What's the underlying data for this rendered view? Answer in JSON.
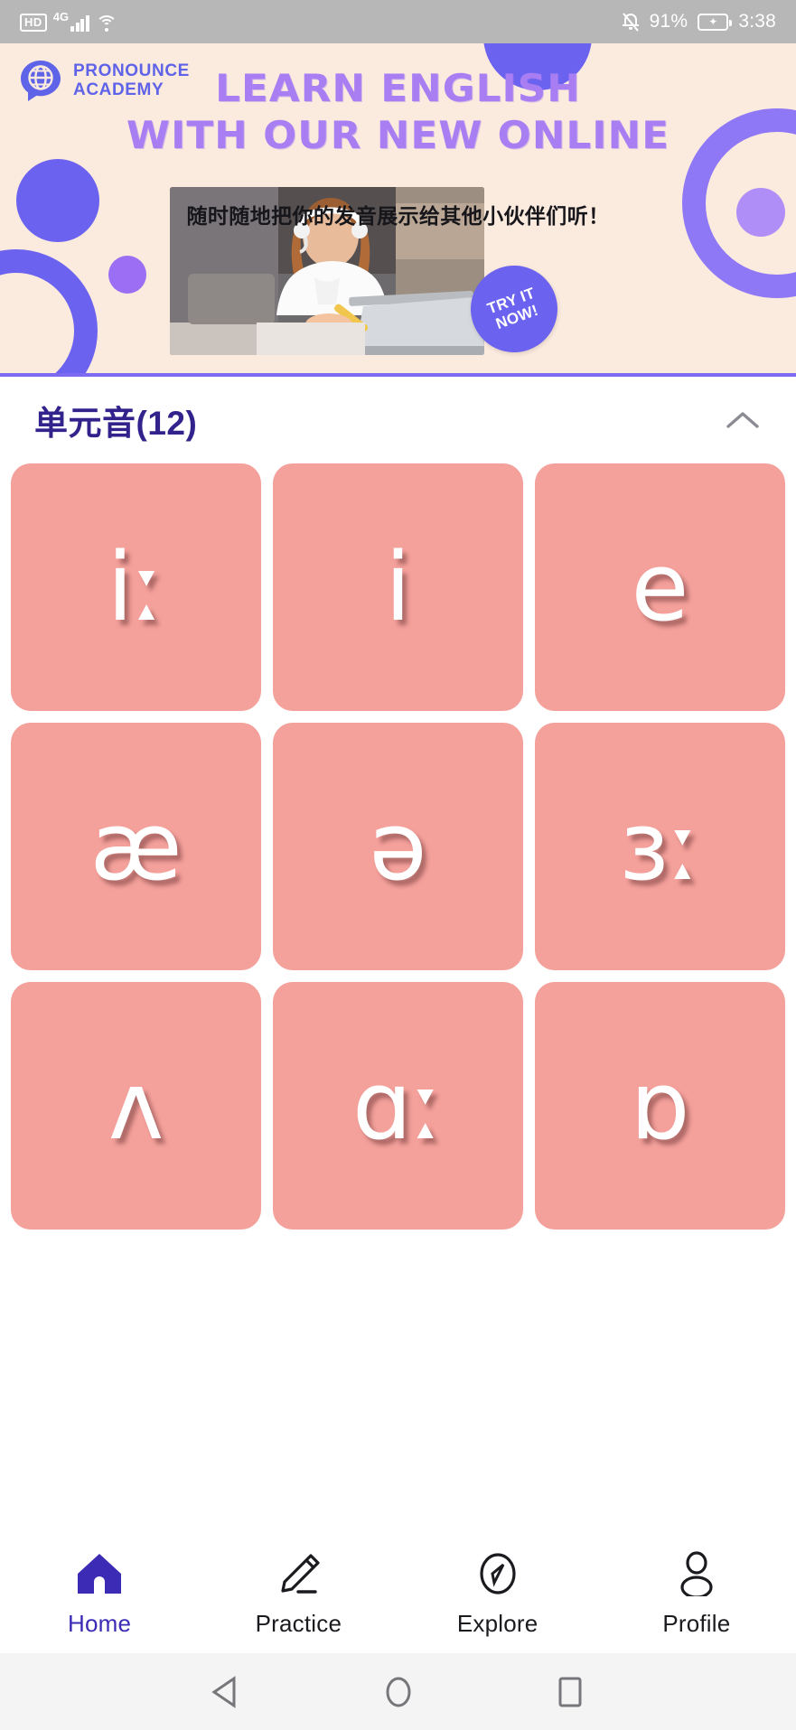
{
  "status_bar": {
    "hd_label": "HD",
    "network_label": "4G",
    "icons": [
      "hd-icon",
      "signal-bars-icon",
      "wifi-icon",
      "bell-muted-icon",
      "battery-charging-icon"
    ],
    "battery_percent": "91%",
    "clock": "3:38"
  },
  "banner": {
    "logo_name_line1": "PRONOUNCE",
    "logo_name_line2": "ACADEMY",
    "headline_line1": "LEARN ENGLISH",
    "headline_line2": "WITH OUR NEW ONLINE",
    "subline": "随时随地把你的发音展示给其他小伙伴们听！",
    "cta_line1": "TRY IT",
    "cta_line2": "NOW!",
    "photo_alt": "woman-with-headset-at-laptop",
    "colors": {
      "background": "#fbeade",
      "headline": "#a97ef2",
      "brand_blue": "#6b63ef",
      "logo_text": "#5f63e8",
      "divider": "#7c6bf0"
    }
  },
  "section": {
    "title": "单元音(12)",
    "collapse_icon": "chevron-up-icon",
    "expanded": true
  },
  "phonemes": [
    {
      "symbol": "iː"
    },
    {
      "symbol": "i"
    },
    {
      "symbol": "e"
    },
    {
      "symbol": "æ"
    },
    {
      "symbol": "ə"
    },
    {
      "symbol": "ɜː"
    },
    {
      "symbol": "ʌ"
    },
    {
      "symbol": "ɑː"
    },
    {
      "symbol": "ɒ"
    }
  ],
  "card_color": "#f4a09b",
  "bottom_nav": {
    "active_index": 0,
    "active_color": "#3b2bb5",
    "items": [
      {
        "label": "Home",
        "icon": "home-icon"
      },
      {
        "label": "Practice",
        "icon": "pencil-icon"
      },
      {
        "label": "Explore",
        "icon": "compass-icon"
      },
      {
        "label": "Profile",
        "icon": "person-icon"
      }
    ]
  },
  "system_nav": {
    "back": "back-triangle-icon",
    "home": "home-circle-icon",
    "recents": "recents-square-icon"
  }
}
